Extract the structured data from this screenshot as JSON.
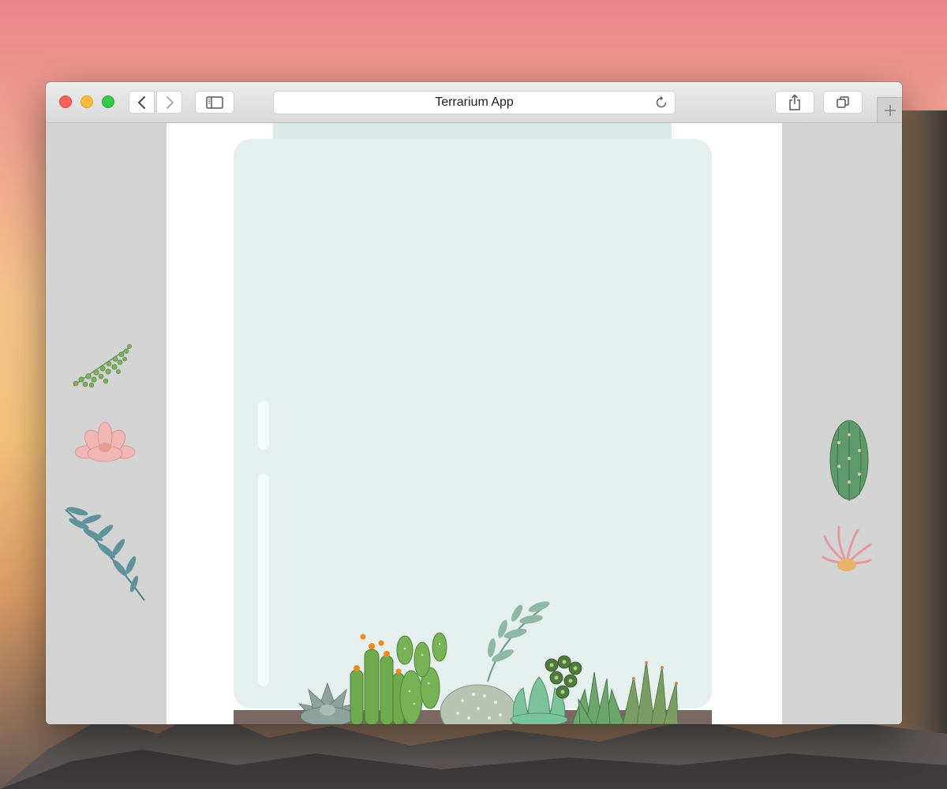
{
  "window": {
    "address_bar_text": "Terrarium App"
  },
  "icons": {
    "back": "chevron-left-icon",
    "forward": "chevron-right-icon",
    "sidebar": "sidebar-icon",
    "reload": "reload-icon",
    "share": "share-icon",
    "tabs": "tabs-icon",
    "new_tab": "plus-icon"
  },
  "colors": {
    "close": "#fc605c",
    "minimize": "#fdbc40",
    "maximize": "#34c84a",
    "jar_glass": "#e5efed",
    "jar_base": "#7a6662",
    "panel_gray": "#d3d3d3"
  },
  "plants": {
    "left_panel": [
      "string-of-pearls-plant",
      "pink-echeveria-plant",
      "eucalyptus-sprig-plant"
    ],
    "right_panel": [
      "green-cactus-plant",
      "pink-air-plant"
    ],
    "in_jar": [
      "gray-rosette-succulent",
      "flowering-cactus",
      "bunny-ear-cactus",
      "fuzzy-ball-cactus",
      "leafy-sprig",
      "green-echeveria",
      "dark-sedum",
      "spiky-aloe",
      "tall-aloe"
    ]
  }
}
